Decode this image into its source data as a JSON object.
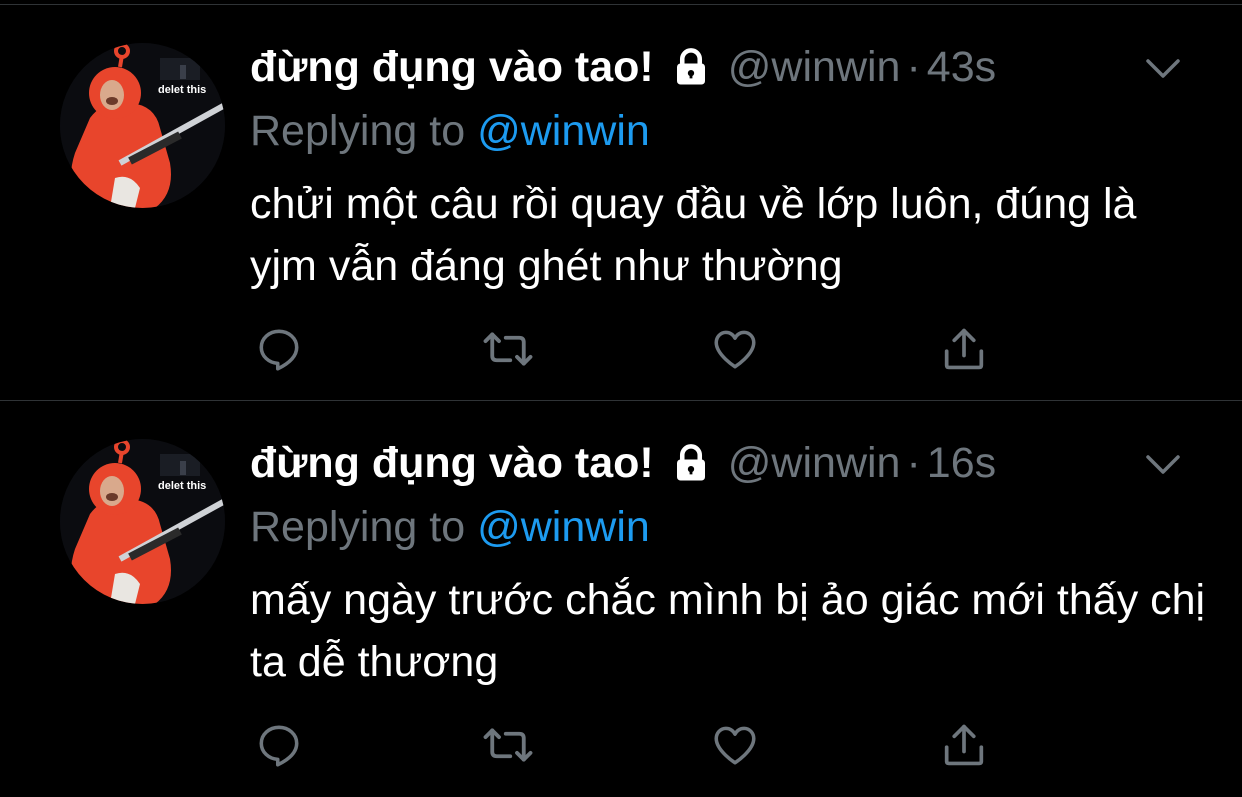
{
  "colors": {
    "background": "#000000",
    "primary_text": "#ffffff",
    "secondary_text": "#6e767d",
    "link": "#1d9bf0",
    "divider": "#2f3336",
    "avatar_suit": "#e8452c"
  },
  "tweets": [
    {
      "display_name": "đừng đụng vào tao!",
      "protected_icon": "lock-icon",
      "handle": "@winwin",
      "separator": "·",
      "time": "43s",
      "replying_prefix": "Replying to",
      "replying_to": "@winwin",
      "text": "chửi một câu rồi quay đầu về lớp luôn, đúng là yjm vẫn đáng ghét như thường",
      "avatar_caption": "delet this",
      "actions": [
        "reply-icon",
        "retweet-icon",
        "like-icon",
        "share-icon"
      ]
    },
    {
      "display_name": "đừng đụng vào tao!",
      "protected_icon": "lock-icon",
      "handle": "@winwin",
      "separator": "·",
      "time": "16s",
      "replying_prefix": "Replying to",
      "replying_to": "@winwin",
      "text": "mấy ngày trước chắc mình bị ảo giác mới thấy chị ta dễ thương",
      "avatar_caption": "delet this",
      "actions": [
        "reply-icon",
        "retweet-icon",
        "like-icon",
        "share-icon"
      ]
    }
  ]
}
